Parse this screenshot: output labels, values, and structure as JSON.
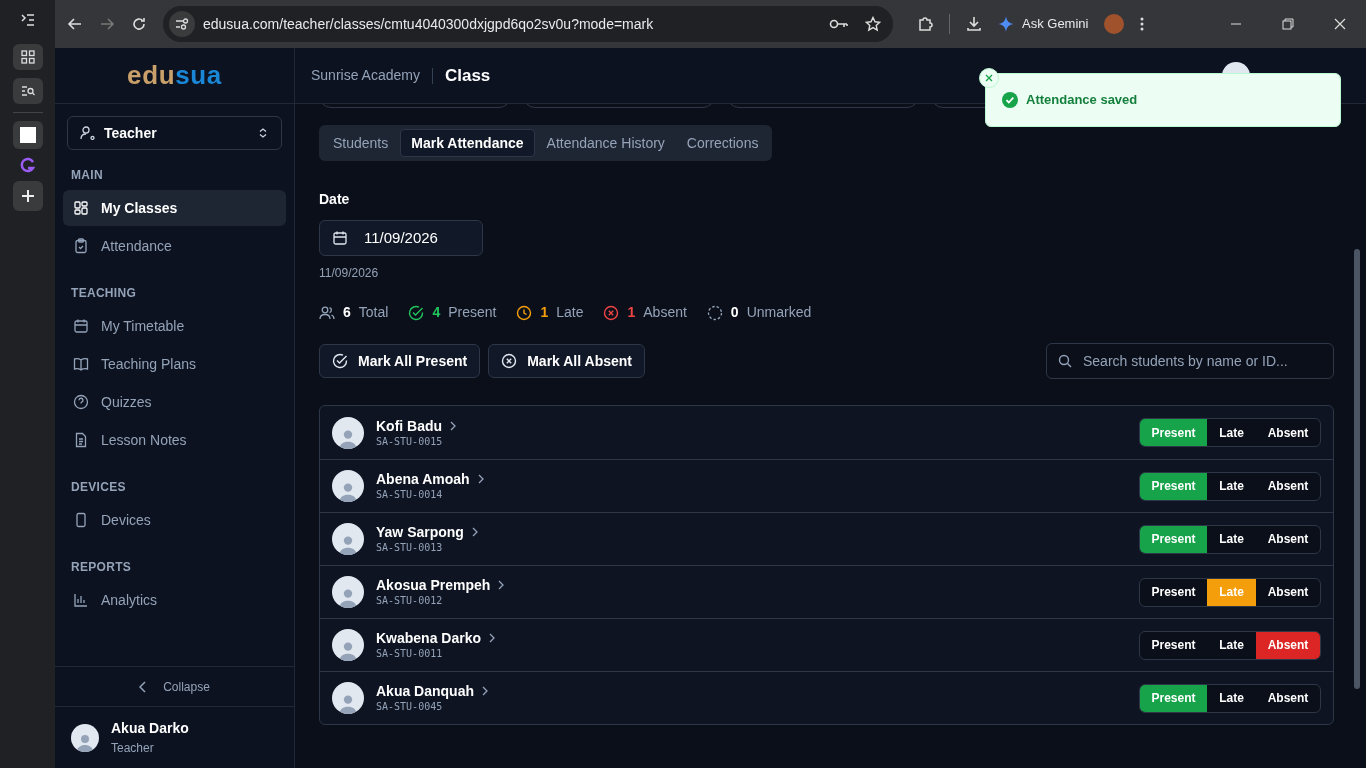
{
  "browser": {
    "url": "edusua.com/teacher/classes/cmtu4040300dxjgpd6qo2sv0u?mode=mark",
    "gemini_label": "Ask Gemini"
  },
  "sidebar": {
    "logo_parts": [
      "edu",
      "sua"
    ],
    "role": "Teacher",
    "sections": [
      {
        "title": "MAIN",
        "items": [
          {
            "label": "My Classes",
            "kind": "grid",
            "selected": true
          },
          {
            "label": "Attendance",
            "kind": "clipboard",
            "selected": false
          }
        ]
      },
      {
        "title": "TEACHING",
        "items": [
          {
            "label": "My Timetable",
            "kind": "calendar",
            "selected": false
          },
          {
            "label": "Teaching Plans",
            "kind": "book",
            "selected": false
          },
          {
            "label": "Quizzes",
            "kind": "help",
            "selected": false
          },
          {
            "label": "Lesson Notes",
            "kind": "file",
            "selected": false
          }
        ]
      },
      {
        "title": "DEVICES",
        "items": [
          {
            "label": "Devices",
            "kind": "phone",
            "selected": false
          }
        ]
      },
      {
        "title": "REPORTS",
        "items": [
          {
            "label": "Analytics",
            "kind": "chart",
            "selected": false
          }
        ]
      }
    ],
    "collapse": "Collapse",
    "user": {
      "name": "Akua Darko",
      "role": "Teacher"
    }
  },
  "header": {
    "school": "Sunrise Academy",
    "page": "Class"
  },
  "toast": {
    "message": "Attendance saved"
  },
  "tabs": [
    {
      "label": "Students",
      "selected": false
    },
    {
      "label": "Mark Attendance",
      "selected": true
    },
    {
      "label": "Attendance History",
      "selected": false
    },
    {
      "label": "Corrections",
      "selected": false
    }
  ],
  "date": {
    "label": "Date",
    "value": "11/09/2026",
    "caption": "11/09/2026"
  },
  "stats": [
    {
      "kind": "total",
      "count": "6",
      "label": "Total"
    },
    {
      "kind": "present",
      "count": "4",
      "label": "Present"
    },
    {
      "kind": "late",
      "count": "1",
      "label": "Late"
    },
    {
      "kind": "absent",
      "count": "1",
      "label": "Absent"
    },
    {
      "kind": "unmarked",
      "count": "0",
      "label": "Unmarked"
    }
  ],
  "actions": [
    {
      "kind": "present",
      "label": "Mark All Present"
    },
    {
      "kind": "absent",
      "label": "Mark All Absent"
    }
  ],
  "search": {
    "placeholder": "Search students by name or ID..."
  },
  "students": [
    {
      "name": "Kofi Badu",
      "id": "SA-STU-0015",
      "options": [
        {
          "kind": "present",
          "label": "Present",
          "selected": true
        },
        {
          "kind": "late",
          "label": "Late",
          "selected": false
        },
        {
          "kind": "absent",
          "label": "Absent",
          "selected": false
        }
      ]
    },
    {
      "name": "Abena Amoah",
      "id": "SA-STU-0014",
      "options": [
        {
          "kind": "present",
          "label": "Present",
          "selected": true
        },
        {
          "kind": "late",
          "label": "Late",
          "selected": false
        },
        {
          "kind": "absent",
          "label": "Absent",
          "selected": false
        }
      ]
    },
    {
      "name": "Yaw Sarpong",
      "id": "SA-STU-0013",
      "options": [
        {
          "kind": "present",
          "label": "Present",
          "selected": true
        },
        {
          "kind": "late",
          "label": "Late",
          "selected": false
        },
        {
          "kind": "absent",
          "label": "Absent",
          "selected": false
        }
      ]
    },
    {
      "name": "Akosua Prempeh",
      "id": "SA-STU-0012",
      "options": [
        {
          "kind": "present",
          "label": "Present",
          "selected": false
        },
        {
          "kind": "late",
          "label": "Late",
          "selected": true
        },
        {
          "kind": "absent",
          "label": "Absent",
          "selected": false
        }
      ]
    },
    {
      "name": "Kwabena Darko",
      "id": "SA-STU-0011",
      "options": [
        {
          "kind": "present",
          "label": "Present",
          "selected": false
        },
        {
          "kind": "late",
          "label": "Late",
          "selected": false
        },
        {
          "kind": "absent",
          "label": "Absent",
          "selected": true
        }
      ]
    },
    {
      "name": "Akua Danquah",
      "id": "SA-STU-0045",
      "options": [
        {
          "kind": "present",
          "label": "Present",
          "selected": true
        },
        {
          "kind": "late",
          "label": "Late",
          "selected": false
        },
        {
          "kind": "absent",
          "label": "Absent",
          "selected": false
        }
      ]
    }
  ]
}
